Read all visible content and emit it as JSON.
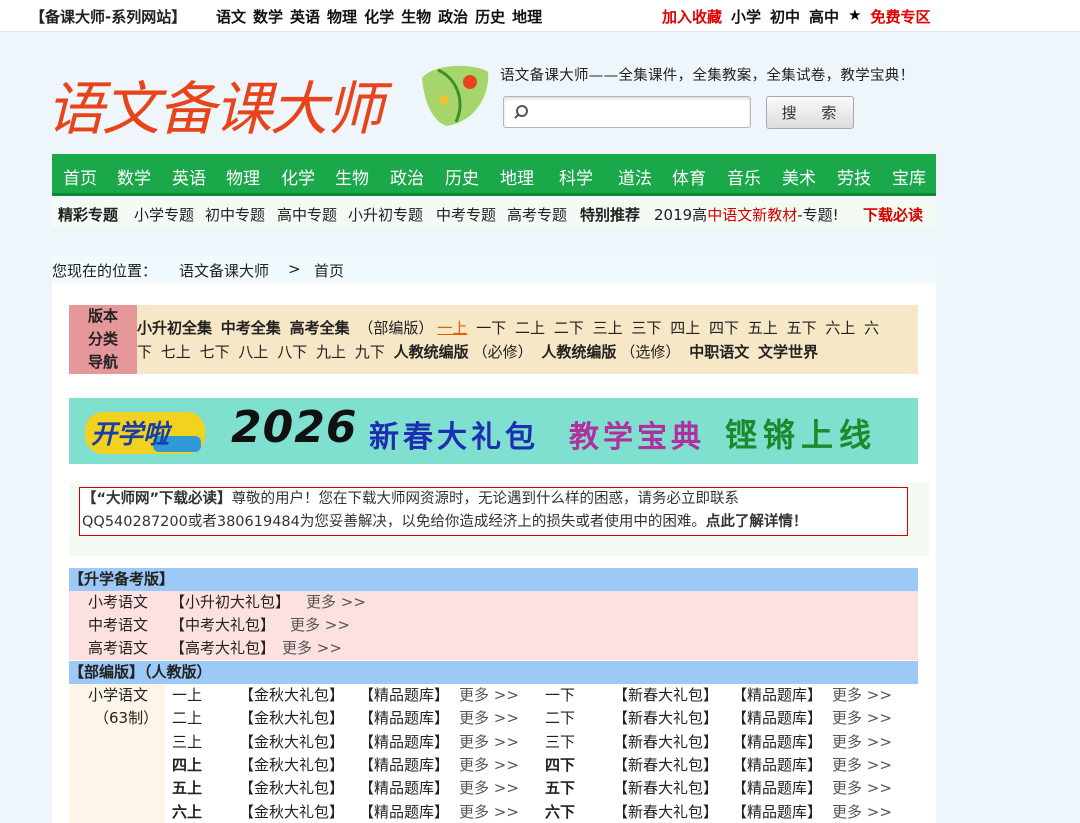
{
  "topbar": {
    "site": "【备课大师-系列网站】",
    "subjects": [
      "语文",
      "数学",
      "英语",
      "物理",
      "化学",
      "生物",
      "政治",
      "历史",
      "地理"
    ],
    "favorite": "加入收藏",
    "levels": [
      "小学",
      "初中",
      "高中"
    ],
    "star": "★",
    "free": "免费专区"
  },
  "header": {
    "logo_text": "语文备课大师",
    "tagline": "语文备课大师——全集课件，全集教案，全集试卷，教学宝典！",
    "search_placeholder": "",
    "search_button": "搜 索"
  },
  "nav": [
    "首页",
    "数学",
    "英语",
    "物理",
    "化学",
    "生物",
    "政治",
    "历史",
    "地理",
    "科学",
    "道法",
    "体育",
    "音乐",
    "美术",
    "劳技",
    "宝库"
  ],
  "topics": {
    "featured": "精彩专题",
    "items": [
      "小学专题",
      "初中专题",
      "高中专题",
      "小升初专题",
      "中考专题",
      "高考专题"
    ],
    "recommend": "特别推荐",
    "promo_a": "2019高",
    "promo_b": "中语文新教材",
    "promo_c": "-专题!",
    "must": "下载必读"
  },
  "breadcrumb": {
    "label": "您现在的位置：",
    "site": "语文备课大师",
    "sep": ">",
    "current": "首页"
  },
  "version_nav": {
    "label": [
      "版本",
      "分类",
      "导航"
    ],
    "row1": {
      "bold": [
        "小升初全集",
        "中考全集",
        "高考全集"
      ],
      "edition": "（部编版）",
      "current": "一上",
      "grades": [
        "一下",
        "二上",
        "二下",
        "三上",
        "三下",
        "四上",
        "四下",
        "五上",
        "五下",
        "六上",
        "六"
      ]
    },
    "row2": {
      "grades": [
        "下",
        "七上",
        "七下",
        "八上",
        "八下",
        "九上",
        "九下"
      ],
      "r1_bold": "人教统编版",
      "r1_note": "（必修）",
      "r2_bold": "人教统编版",
      "r2_note": "（选修）",
      "vocational": "中职语文",
      "world": "文学世界"
    }
  },
  "banner": {
    "badge": "开学啦",
    "year": "2026",
    "phrase1": "新春大礼包",
    "phrase2": "教学宝典",
    "phrase3": "铿锵上线"
  },
  "notice": {
    "title": "【“大师网”下载必读】",
    "line1": "尊敬的用户！您在下载大师网资源时，无论遇到什么样的困惑，请务必立即联系",
    "line2": "QQ540287200或者380619484为您妥善解决，以免给你造成经济上的损失或者使用中的困难。",
    "link": "点此了解详情！"
  },
  "exam_section": {
    "title": "【升学备考版】",
    "rows": [
      {
        "name": "小考语文",
        "pack": "【小升初大礼包】",
        "more": "更多 >>"
      },
      {
        "name": "中考语文",
        "pack": "【中考大礼包】",
        "more": "更多 >>"
      },
      {
        "name": "高考语文",
        "pack": "【高考大礼包】",
        "more": "更多 >>"
      }
    ]
  },
  "edition_section": {
    "title": "【部编版】（人教版）",
    "category": "小学语文",
    "system": "（63制）",
    "autumn_pack": "【金秋大礼包】",
    "spring_pack": "【新春大礼包】",
    "bank": "【精品题库】",
    "more": "更多 >>",
    "rows": [
      {
        "up": "一上",
        "down": "一下",
        "bold": false
      },
      {
        "up": "二上",
        "down": "二下",
        "bold": false
      },
      {
        "up": "三上",
        "down": "三下",
        "bold": false
      },
      {
        "up": "四上",
        "down": "四下",
        "bold": true
      },
      {
        "up": "五上",
        "down": "五下",
        "bold": true
      },
      {
        "up": "六上",
        "down": "六下",
        "bold": true
      }
    ]
  }
}
